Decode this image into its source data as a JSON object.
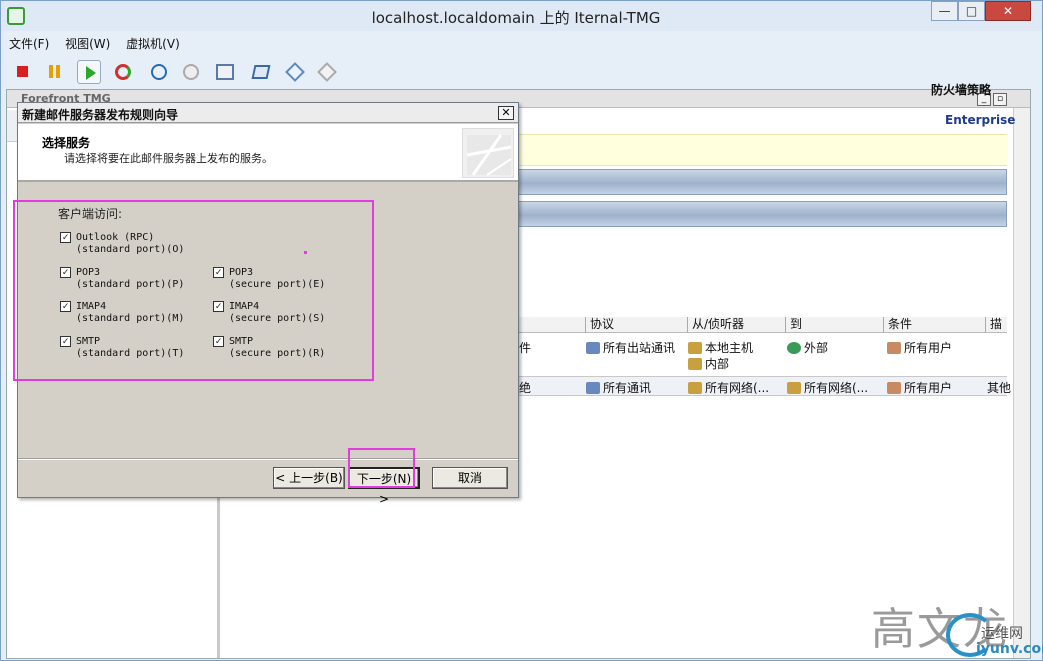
{
  "window": {
    "title": "localhost.localdomain 上的 Iternal-TMG",
    "minimize": "—",
    "maximize": "□",
    "close": "✕"
  },
  "menu": [
    "文件(F)",
    "视图(W)",
    "虚拟机(V)"
  ],
  "toolbar_icons": [
    "stop-icon",
    "pause-icon",
    "play-icon",
    "reset-icon",
    "snapshot-icon",
    "revert-icon",
    "manage-snapshots-icon",
    "send-keys-icon",
    "settings-icon",
    "tools-icon"
  ],
  "tmg": {
    "title": "Forefront TMG",
    "firewall_policy_title": "防火墙策略",
    "enterprise_label": "Enterprise",
    "columns": [
      "协议",
      "从/侦听器",
      "到",
      "条件",
      "描述"
    ],
    "rows": [
      {
        "name_suffix": "件",
        "protocol": "所有出站通讯",
        "from": [
          "本地主机",
          "内部"
        ],
        "to": "外部",
        "condition": "所有用户",
        "description": ""
      },
      {
        "name_suffix": "绝",
        "protocol": "所有通讯",
        "from": [
          "所有网络(..."
        ],
        "to": "所有网络(...",
        "condition": "所有用户",
        "description": "其他"
      }
    ]
  },
  "wizard": {
    "title": "新建邮件服务器发布规则向导",
    "heading": "选择服务",
    "subheading": "请选择将要在此邮件服务器上发布的服务。",
    "group_label": "客户端访问:",
    "options": [
      {
        "l1": "Outlook (RPC)",
        "l2": "(standard port)(O)",
        "checked": true
      },
      {
        "l1": "POP3",
        "l2": "(standard port)(P)",
        "checked": true
      },
      {
        "l1": "POP3",
        "l2": "(secure port)(E)",
        "checked": true
      },
      {
        "l1": "IMAP4",
        "l2": "(standard port)(M)",
        "checked": true
      },
      {
        "l1": "IMAP4",
        "l2": "(secure port)(S)",
        "checked": true
      },
      {
        "l1": "SMTP",
        "l2": "(standard port)(T)",
        "checked": true
      },
      {
        "l1": "SMTP",
        "l2": "(secure port)(R)",
        "checked": true
      }
    ],
    "check_mark": "✓",
    "buttons": {
      "back": "< 上一步(B)",
      "next": "下一步(N) >",
      "cancel": "取消"
    }
  },
  "watermark": {
    "text": "高文龙",
    "site": "运维网",
    "url": "iyunv.com"
  },
  "colors": {
    "highlight": "#e23be0",
    "accent": "#1e3c8c"
  }
}
